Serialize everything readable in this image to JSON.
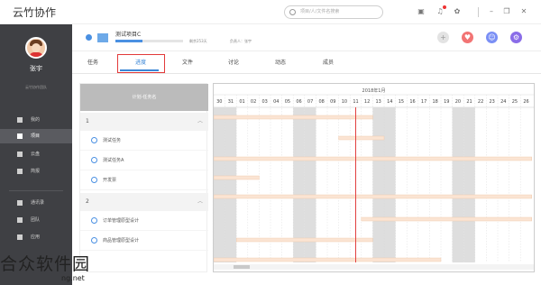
{
  "app": {
    "title": "云竹协作"
  },
  "titlebar": {
    "search_placeholder": "项目/人/文件名搜索",
    "icons": [
      "image-icon",
      "bell-icon",
      "gear-icon",
      "minimize-icon",
      "restore-icon",
      "close-icon"
    ]
  },
  "sidebar": {
    "user_name": "张宇",
    "user_org": "云竹协作团队",
    "items": [
      {
        "label": "我的",
        "icon": "person-icon"
      },
      {
        "label": "项目",
        "icon": "project-icon",
        "active": true
      },
      {
        "label": "云盘",
        "icon": "cloud-icon"
      },
      {
        "label": "简报",
        "icon": "report-icon"
      },
      {
        "label": "通讯录",
        "icon": "contacts-icon"
      },
      {
        "label": "团队",
        "icon": "team-icon"
      },
      {
        "label": "应用",
        "icon": "apps-icon"
      }
    ]
  },
  "project": {
    "name": "测试项目C",
    "progress": 0.4,
    "remaining": "剩余253天",
    "owner": "负责人：张宇",
    "header_buttons": [
      {
        "icon": "add-icon",
        "color": "#e3e3e3"
      },
      {
        "icon": "heart-icon",
        "color": "#f27474"
      },
      {
        "icon": "user-icon",
        "color": "#7a8ff5"
      },
      {
        "icon": "settings-icon",
        "color": "#8a6de8"
      }
    ]
  },
  "tabs": [
    {
      "label": "任务"
    },
    {
      "label": "进度",
      "active": true
    },
    {
      "label": "文件"
    },
    {
      "label": "讨论"
    },
    {
      "label": "动态"
    },
    {
      "label": "成员"
    }
  ],
  "task_panel": {
    "header": "计划-任务名",
    "groups": [
      {
        "label": "1",
        "tasks": [
          "测试任务",
          "测试任务A",
          "开发票"
        ]
      },
      {
        "label": "2",
        "tasks": [
          "订单管理原型设计",
          "商品管理原型设计"
        ]
      }
    ]
  },
  "gantt": {
    "month_label": "2018年1月",
    "days": [
      "30",
      "31",
      "01",
      "02",
      "03",
      "04",
      "05",
      "06",
      "07",
      "08",
      "09",
      "10",
      "11",
      "12",
      "13",
      "14",
      "15",
      "16",
      "17",
      "18",
      "19",
      "20",
      "21",
      "22",
      "23",
      "24",
      "25",
      "26"
    ],
    "weekend_days": [
      "30",
      "31",
      "06",
      "07",
      "13",
      "14",
      "20",
      "21"
    ],
    "today": "11",
    "bars": [
      {
        "start": "30",
        "end": "12"
      },
      {
        "start": "10",
        "end": "13"
      },
      {
        "start": "30",
        "end": "26"
      },
      {
        "start": "30",
        "end": "02"
      },
      {
        "start": "30",
        "end": "26"
      },
      {
        "start": "12",
        "end": "26"
      },
      {
        "start": "01",
        "end": "12"
      },
      {
        "start": "30",
        "end": "18"
      }
    ]
  },
  "watermark": {
    "text": "合众软件园",
    "url": "ng.net"
  },
  "colors": {
    "accent": "#3a86d6",
    "highlight": "#e23a3a",
    "bar": "#fbe4d3",
    "today": "#e24040",
    "weekend": "#dedede"
  }
}
